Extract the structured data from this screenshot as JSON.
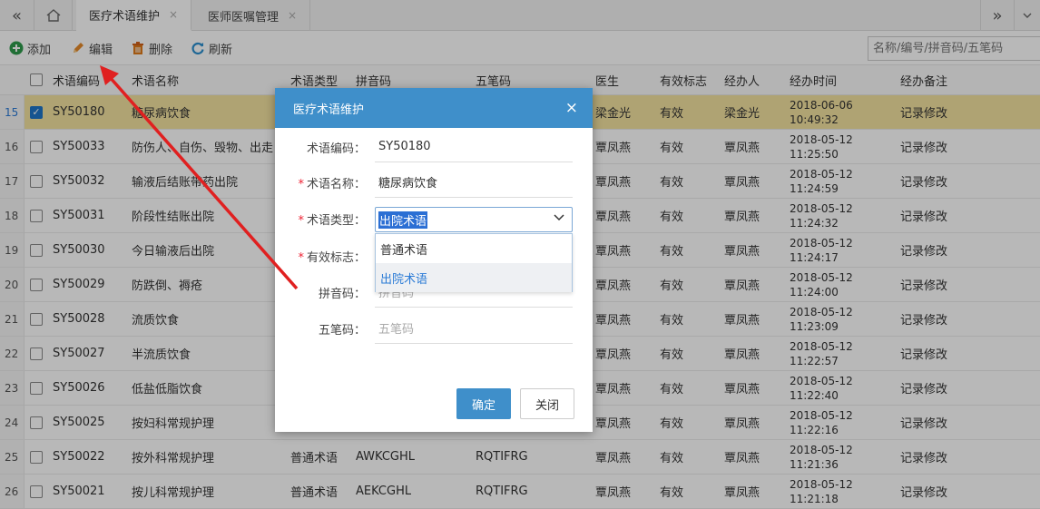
{
  "tabs": {
    "prev_icon": "double-chevron-left",
    "home_icon": "home",
    "next_icon": "double-chevron-right",
    "items": [
      {
        "label": "医疗术语维护",
        "close": "×",
        "active": true
      },
      {
        "label": "医师医嘱管理",
        "close": "×",
        "active": false
      }
    ]
  },
  "toolbar": {
    "add_label": "添加",
    "edit_label": "编辑",
    "delete_label": "删除",
    "refresh_label": "刷新",
    "search_placeholder": "名称/编号/拼音码/五笔码"
  },
  "grid": {
    "headers": [
      "术语编码",
      "术语名称",
      "术语类型",
      "拼音码",
      "五笔码",
      "医生",
      "有效标志",
      "经办人",
      "经办时间",
      "经办备注"
    ],
    "rows": [
      {
        "no": "15",
        "code": "SY50180",
        "name": "糖尿病饮食",
        "type": "",
        "py": "",
        "wb": "",
        "doctor": "梁金光",
        "valid": "有效",
        "handler": "梁金光",
        "date": "2018-06-06",
        "time": "10:49:32",
        "remark": "记录修改",
        "selected": true
      },
      {
        "no": "16",
        "code": "SY50033",
        "name": "防伤人、自伤、毁物、出走",
        "type": "",
        "py": "",
        "wb": "",
        "doctor": "覃凤燕",
        "valid": "有效",
        "handler": "覃凤燕",
        "date": "2018-05-12",
        "time": "11:25:50",
        "remark": "记录修改"
      },
      {
        "no": "17",
        "code": "SY50032",
        "name": "输液后结账带药出院",
        "type": "",
        "py": "",
        "wb": "",
        "doctor": "覃凤燕",
        "valid": "有效",
        "handler": "覃凤燕",
        "date": "2018-05-12",
        "time": "11:24:59",
        "remark": "记录修改"
      },
      {
        "no": "18",
        "code": "SY50031",
        "name": "阶段性结账出院",
        "type": "",
        "py": "",
        "wb": "",
        "doctor": "覃凤燕",
        "valid": "有效",
        "handler": "覃凤燕",
        "date": "2018-05-12",
        "time": "11:24:32",
        "remark": "记录修改"
      },
      {
        "no": "19",
        "code": "SY50030",
        "name": "今日输液后出院",
        "type": "",
        "py": "",
        "wb": "",
        "doctor": "覃凤燕",
        "valid": "有效",
        "handler": "覃凤燕",
        "date": "2018-05-12",
        "time": "11:24:17",
        "remark": "记录修改"
      },
      {
        "no": "20",
        "code": "SY50029",
        "name": "防跌倒、褥疮",
        "type": "",
        "py": "",
        "wb": "",
        "doctor": "覃凤燕",
        "valid": "有效",
        "handler": "覃凤燕",
        "date": "2018-05-12",
        "time": "11:24:00",
        "remark": "记录修改"
      },
      {
        "no": "21",
        "code": "SY50028",
        "name": "流质饮食",
        "type": "",
        "py": "",
        "wb": "",
        "doctor": "覃凤燕",
        "valid": "有效",
        "handler": "覃凤燕",
        "date": "2018-05-12",
        "time": "11:23:09",
        "remark": "记录修改"
      },
      {
        "no": "22",
        "code": "SY50027",
        "name": "半流质饮食",
        "type": "",
        "py": "",
        "wb": "",
        "doctor": "覃凤燕",
        "valid": "有效",
        "handler": "覃凤燕",
        "date": "2018-05-12",
        "time": "11:22:57",
        "remark": "记录修改"
      },
      {
        "no": "23",
        "code": "SY50026",
        "name": "低盐低脂饮食",
        "type": "",
        "py": "",
        "wb": "",
        "doctor": "覃凤燕",
        "valid": "有效",
        "handler": "覃凤燕",
        "date": "2018-05-12",
        "time": "11:22:40",
        "remark": "记录修改"
      },
      {
        "no": "24",
        "code": "SY50025",
        "name": "按妇科常规护理",
        "type": "",
        "py": "",
        "wb": "",
        "doctor": "覃凤燕",
        "valid": "有效",
        "handler": "覃凤燕",
        "date": "2018-05-12",
        "time": "11:22:16",
        "remark": "记录修改"
      },
      {
        "no": "25",
        "code": "SY50022",
        "name": "按外科常规护理",
        "type": "普通术语",
        "py": "AWKCGHL",
        "wb": "RQTIFRG",
        "doctor": "覃凤燕",
        "valid": "有效",
        "handler": "覃凤燕",
        "date": "2018-05-12",
        "time": "11:21:36",
        "remark": "记录修改"
      },
      {
        "no": "26",
        "code": "SY50021",
        "name": "按儿科常规护理",
        "type": "普通术语",
        "py": "AEKCGHL",
        "wb": "RQTIFRG",
        "doctor": "覃凤燕",
        "valid": "有效",
        "handler": "覃凤燕",
        "date": "2018-05-12",
        "time": "11:21:18",
        "remark": "记录修改"
      }
    ]
  },
  "dialog": {
    "title": "医疗术语维护",
    "close": "×",
    "code_label": "术语编码：",
    "code_value": "SY50180",
    "name_label": "术语名称：",
    "name_value": "糖尿病饮食",
    "type_label": "术语类型：",
    "type_value": "出院术语",
    "type_options": [
      "普通术语",
      "出院术语"
    ],
    "valid_label": "有效标志：",
    "py_label": "拼音码：",
    "py_placeholder": "拼音码",
    "wb_label": "五笔码：",
    "wb_placeholder": "五笔码",
    "required_mark": "*",
    "ok_label": "确定",
    "close_label": "关闭"
  },
  "colors": {
    "accent": "#3f8fca",
    "selected_row": "#f3e2a0",
    "arrow": "#e02020"
  }
}
